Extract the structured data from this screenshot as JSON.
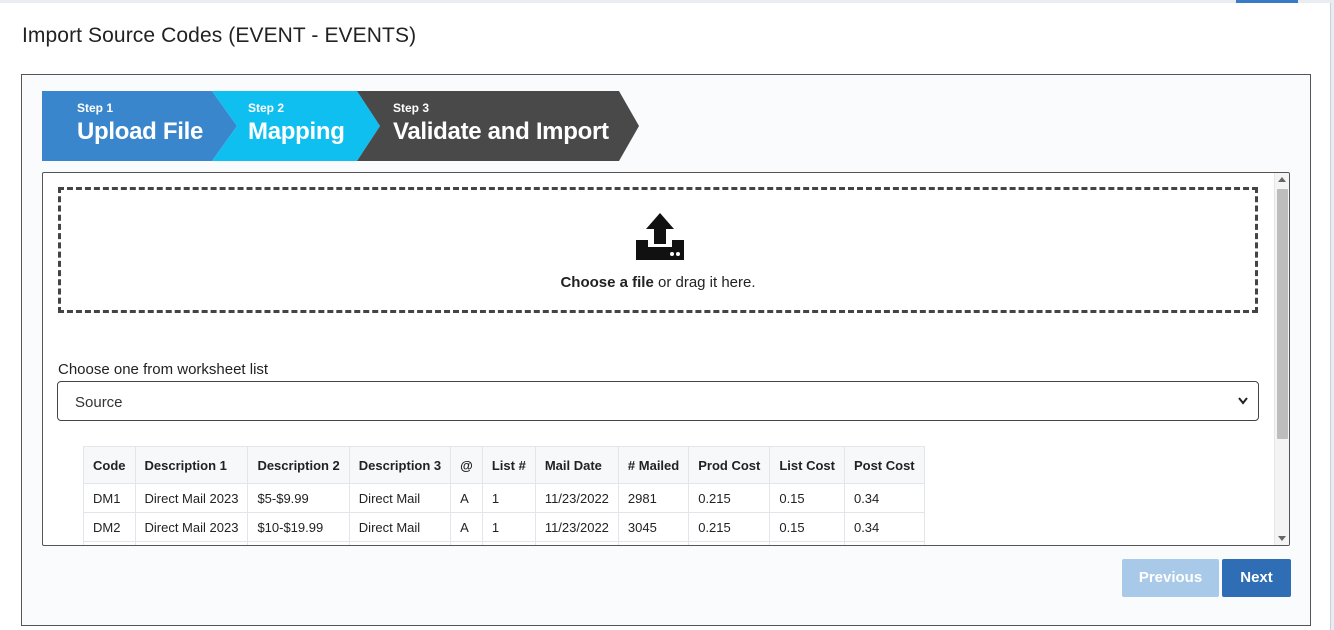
{
  "modal": {
    "title": "Import Source Codes (EVENT - EVENTS)"
  },
  "steps": [
    {
      "small": "Step 1",
      "big": "Upload File",
      "color": "#3a86cc"
    },
    {
      "small": "Step 2",
      "big": "Mapping",
      "color": "#0fbfef"
    },
    {
      "small": "Step 3",
      "big": "Validate and Import",
      "color": "#494949"
    }
  ],
  "dropzone": {
    "icon": "upload-icon",
    "choose": "Choose a file",
    "rest": " or drag it here."
  },
  "worksheet": {
    "label": "Choose one from worksheet list",
    "selected": "Source"
  },
  "table": {
    "headers": [
      "Code",
      "Description 1",
      "Description 2",
      "Description 3",
      "@",
      "List #",
      "Mail Date",
      "# Mailed",
      "Prod Cost",
      "List Cost",
      "Post Cost"
    ],
    "rows": [
      [
        "DM1",
        "Direct Mail 2023",
        "$5-$9.99",
        "Direct Mail",
        "A",
        "1",
        "11/23/2022",
        "2981",
        "0.215",
        "0.15",
        "0.34"
      ],
      [
        "DM2",
        "Direct Mail 2023",
        "$10-$19.99",
        "Direct Mail",
        "A",
        "1",
        "11/23/2022",
        "3045",
        "0.215",
        "0.15",
        "0.34"
      ],
      [
        "",
        "",
        "",
        "",
        "",
        "",
        "",
        "",
        "",
        "",
        ""
      ]
    ]
  },
  "buttons": {
    "previous": "Previous",
    "next": "Next"
  }
}
